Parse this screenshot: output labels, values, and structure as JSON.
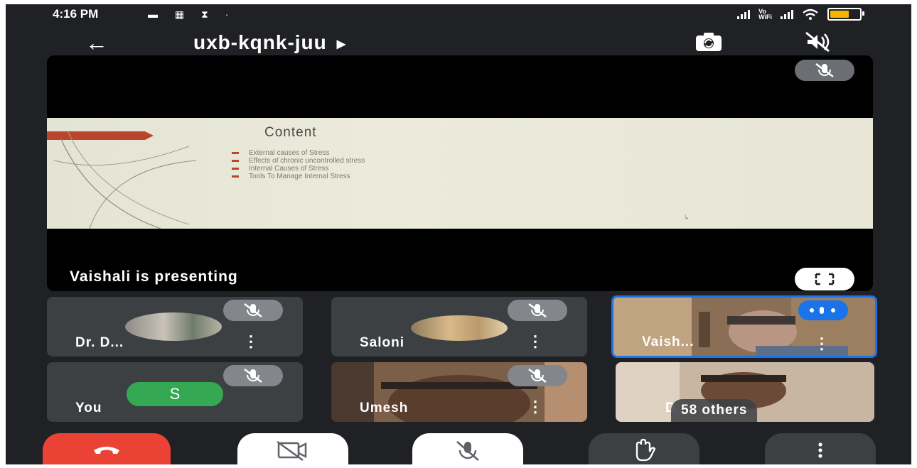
{
  "status_bar": {
    "time": "4:16 PM",
    "left_icons": "▬ ▦ ⧗ ·",
    "vowifi": "Vo\nWiFi"
  },
  "meeting": {
    "title": "uxb-kqnk-juu"
  },
  "presentation": {
    "slide_title": "Content",
    "slide_items": [
      "External causes  of Stress",
      "Effects of chronic uncontrolled stress",
      "Internal Causes of Stress",
      "Tools To Manage Internal Stress"
    ],
    "presenter_label": "Vaishali is presenting"
  },
  "participants": [
    {
      "name": "Dr. D..."
    },
    {
      "name": "Saloni"
    },
    {
      "name": "Vaish..."
    },
    {
      "name": "You",
      "avatar_letter": "S"
    },
    {
      "name": "Umesh"
    },
    {
      "name": "D",
      "others": "58 others"
    }
  ],
  "colors": {
    "background": "#202124",
    "tile": "#3c4043",
    "end_call": "#ea4335",
    "speaking_accent": "#1a73e8",
    "you_avatar": "#34a853"
  },
  "icons": [
    "back-arrow-icon",
    "switch-camera-icon",
    "audio-off-icon",
    "mic-off-icon",
    "more-vert-icon",
    "fullscreen-icon",
    "end-call-icon",
    "camera-off-icon",
    "raise-hand-icon"
  ]
}
